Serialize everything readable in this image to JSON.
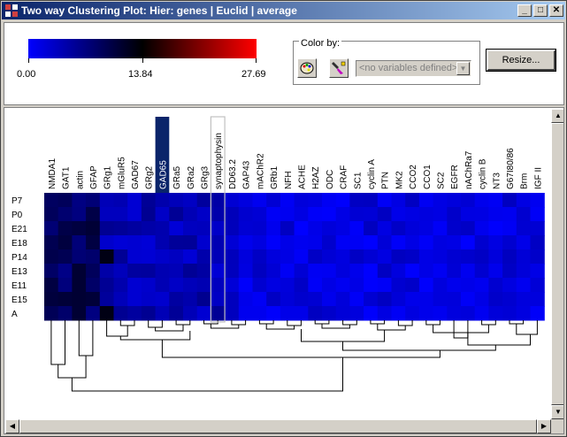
{
  "window": {
    "title": "Two way Clustering Plot: Hier: genes  | Euclid | average",
    "minimize_glyph": "_",
    "maximize_glyph": "□",
    "close_glyph": "✕"
  },
  "legend": {
    "min_label": "0.00",
    "mid_label": "13.84",
    "max_label": "27.69",
    "colors": {
      "low": "#0000ff",
      "mid": "#000000",
      "high": "#ff0000"
    }
  },
  "color_by": {
    "label": "Color by:",
    "palette_icon": "palette-icon",
    "picker_icon": "color-picker-icon",
    "select_value": "<no variables defined>"
  },
  "resize_button": "Resize...",
  "chart_data": {
    "type": "heatmap",
    "columns": [
      "NMDA1",
      "GAT1",
      "actin",
      "GFAP",
      "GRg1",
      "mGluR5",
      "GAD67",
      "GRg2",
      "GAD65",
      "GRa5",
      "GRa2",
      "GRg3",
      "synaptophysin",
      "DD63.2",
      "GAP43",
      "mAChR2",
      "GRb1",
      "NFH",
      "ACHE",
      "H2AZ",
      "ODC",
      "CRAF",
      "SC1",
      "cyclin A",
      "PTN",
      "MK2",
      "CCO2",
      "CCO1",
      "SC2",
      "EGFR",
      "nAChRa7",
      "cyclin B",
      "NT3",
      "G67I80/86",
      "Brm",
      "IGF II"
    ],
    "rows": [
      "P7",
      "P0",
      "E21",
      "E18",
      "P14",
      "E13",
      "E11",
      "E15",
      "A"
    ],
    "selected_column": "GAD65",
    "outlined_column": "synaptophysin",
    "value_range": [
      0,
      27.69
    ]
  }
}
